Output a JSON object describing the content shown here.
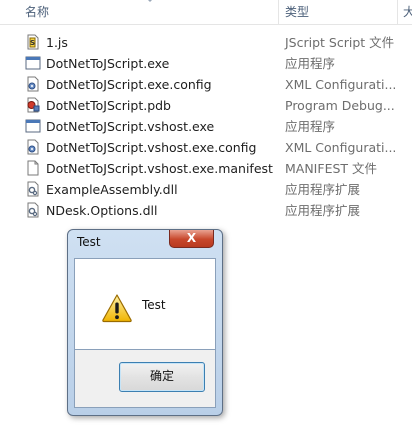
{
  "header": {
    "name_col": "名称",
    "type_col": "类型",
    "extra_col": "大"
  },
  "files": [
    {
      "name": "1.js",
      "type": "JScript Script 文件",
      "icon": "jscript-file-icon"
    },
    {
      "name": "DotNetToJScript.exe",
      "type": "应用程序",
      "icon": "exe-window-icon"
    },
    {
      "name": "DotNetToJScript.exe.config",
      "type": "XML Configurati...",
      "icon": "config-file-icon"
    },
    {
      "name": "DotNetToJScript.pdb",
      "type": "Program Debug...",
      "icon": "pdb-file-icon"
    },
    {
      "name": "DotNetToJScript.vshost.exe",
      "type": "应用程序",
      "icon": "exe-window-icon"
    },
    {
      "name": "DotNetToJScript.vshost.exe.config",
      "type": "XML Configurati...",
      "icon": "config-file-icon"
    },
    {
      "name": "DotNetToJScript.vshost.exe.manifest",
      "type": "MANIFEST 文件",
      "icon": "blank-file-icon"
    },
    {
      "name": "ExampleAssembly.dll",
      "type": "应用程序扩展",
      "icon": "dll-file-icon"
    },
    {
      "name": "NDesk.Options.dll",
      "type": "应用程序扩展",
      "icon": "dll-file-icon"
    }
  ],
  "dialog": {
    "title": "Test",
    "close_label": "X",
    "message": "Test",
    "icon": "warning-icon",
    "ok_label": "确定"
  }
}
